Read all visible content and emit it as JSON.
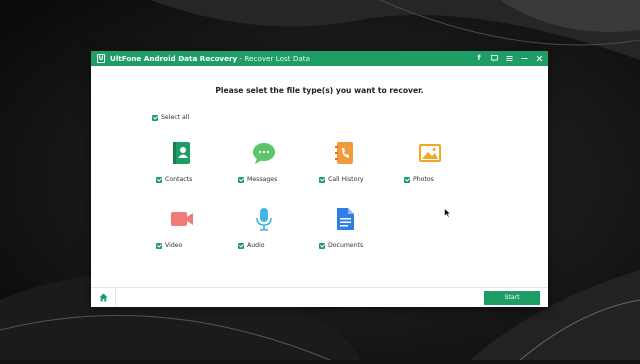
{
  "window": {
    "app_name": "UltFone Android Data Recovery",
    "subtitle": " - Recover Lost Data",
    "logo_letter": "U"
  },
  "titlebar_icons": [
    {
      "name": "facebook-icon",
      "glyph": "f"
    },
    {
      "name": "feedback-icon",
      "glyph": "▭"
    },
    {
      "name": "menu-icon",
      "glyph": "≡"
    },
    {
      "name": "minimize-icon",
      "glyph": "—"
    },
    {
      "name": "close-icon",
      "glyph": "✕"
    }
  ],
  "heading": "Please selet the file type(s) you want to recover.",
  "select_all": {
    "label": "Select all",
    "checked": true
  },
  "file_types": [
    {
      "label": "Contacts",
      "icon": "contacts-icon",
      "color": "#1e9e64",
      "checked": true
    },
    {
      "label": "Messages",
      "icon": "messages-icon",
      "color": "#5cc46a",
      "checked": true
    },
    {
      "label": "Call History",
      "icon": "call-history-icon",
      "color": "#f29a3a",
      "checked": true
    },
    {
      "label": "Photos",
      "icon": "photos-icon",
      "color": "#f2a826",
      "checked": true
    },
    {
      "label": "Video",
      "icon": "video-icon",
      "color": "#f07c78",
      "checked": true
    },
    {
      "label": "Audio",
      "icon": "audio-icon",
      "color": "#3fb6e6",
      "checked": true
    },
    {
      "label": "Documents",
      "icon": "documents-icon",
      "color": "#2f7fe6",
      "checked": true
    }
  ],
  "footer": {
    "start_label": "Start",
    "home_icon": "home-icon"
  },
  "colors": {
    "accent": "#1e9e64"
  }
}
